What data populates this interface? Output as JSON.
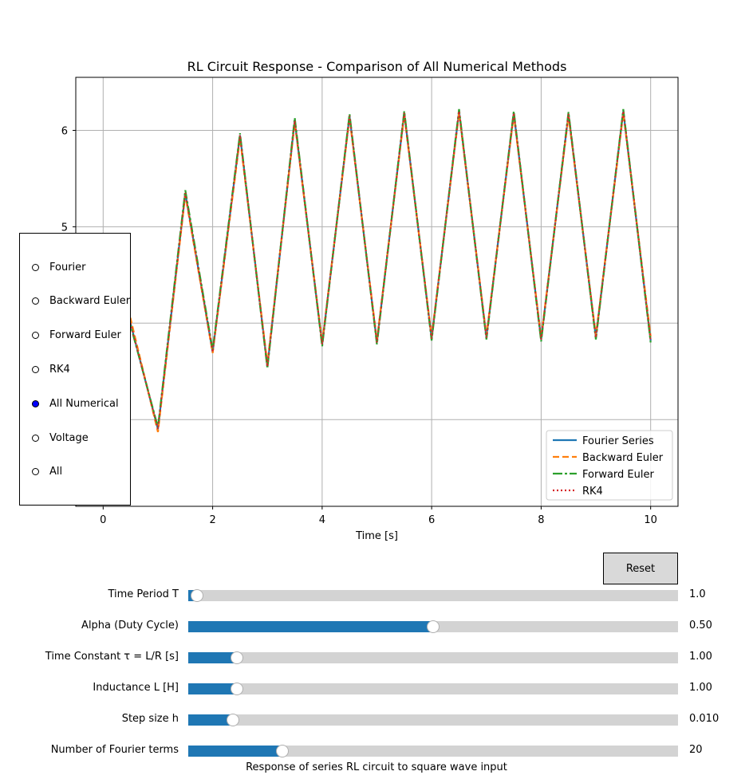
{
  "chart_data": {
    "type": "line",
    "title": "RL Circuit Response - Comparison of All Numerical Methods",
    "xlabel": "Time [s]",
    "ylabel": "",
    "xlim": [
      -0.5,
      10.5
    ],
    "ylim": [
      2.1,
      6.55
    ],
    "xticks": [
      0,
      2,
      4,
      6,
      8,
      10
    ],
    "yticks": [
      3,
      4,
      5,
      6
    ],
    "yticks_labeled": [
      5,
      6
    ],
    "grid": true,
    "legend_position": "bottom-right",
    "x": [
      0,
      0.5,
      1,
      1.5,
      2,
      2.5,
      3,
      3.5,
      4,
      4.5,
      5,
      5.5,
      6,
      6.5,
      7,
      7.5,
      8,
      8.5,
      9,
      9.5,
      10
    ],
    "series": [
      {
        "name": "Fourier Series",
        "color": "#1f77b4",
        "dash": "none",
        "values": [
          4.3,
          4.0,
          2.9,
          5.35,
          3.7,
          5.95,
          3.55,
          6.1,
          3.78,
          6.15,
          3.8,
          6.18,
          3.84,
          6.2,
          3.85,
          6.18,
          3.83,
          6.17,
          3.85,
          6.2,
          3.82
        ]
      },
      {
        "name": "Backward Euler",
        "color": "#ff7f0e",
        "dash": "8,4",
        "values": [
          4.35,
          4.05,
          2.87,
          5.33,
          3.69,
          5.92,
          3.58,
          6.08,
          3.8,
          6.13,
          3.82,
          6.16,
          3.86,
          6.18,
          3.87,
          6.16,
          3.85,
          6.15,
          3.87,
          6.18,
          3.86
        ]
      },
      {
        "name": "Forward Euler",
        "color": "#2ca02c",
        "dash": "12,3,3,3",
        "values": [
          4.3,
          3.98,
          2.92,
          5.38,
          3.72,
          5.97,
          3.53,
          6.13,
          3.76,
          6.17,
          3.78,
          6.2,
          3.82,
          6.22,
          3.83,
          6.2,
          3.81,
          6.19,
          3.83,
          6.22,
          3.8
        ]
      },
      {
        "name": "RK4",
        "color": "#d62728",
        "dash": "2,3",
        "values": [
          4.3,
          4.0,
          2.9,
          5.35,
          3.7,
          5.95,
          3.55,
          6.1,
          3.78,
          6.15,
          3.8,
          6.18,
          3.84,
          6.2,
          3.85,
          6.18,
          3.83,
          6.17,
          3.85,
          6.2,
          3.82
        ]
      }
    ]
  },
  "radio": {
    "options": [
      "Fourier",
      "Backward Euler",
      "Forward Euler",
      "RK4",
      "All Numerical",
      "Voltage",
      "All"
    ],
    "selected": "All Numerical",
    "selected_color": "#0000ff"
  },
  "reset_label": "Reset",
  "sliders": [
    {
      "label": "Time Period T",
      "value_text": "1.0",
      "fraction": 0.018
    },
    {
      "label": "Alpha (Duty Cycle)",
      "value_text": "0.50",
      "fraction": 0.5
    },
    {
      "label": "Time Constant τ = L/R [s]",
      "value_text": "1.00",
      "fraction": 0.1
    },
    {
      "label": "Inductance L [H]",
      "value_text": "1.00",
      "fraction": 0.1
    },
    {
      "label": "Step size h",
      "value_text": "0.010",
      "fraction": 0.092
    },
    {
      "label": "Number of Fourier terms",
      "value_text": "20",
      "fraction": 0.192
    }
  ],
  "slider_fill_color": "#1f77b4",
  "caption": "Response of series RL circuit to square wave input"
}
